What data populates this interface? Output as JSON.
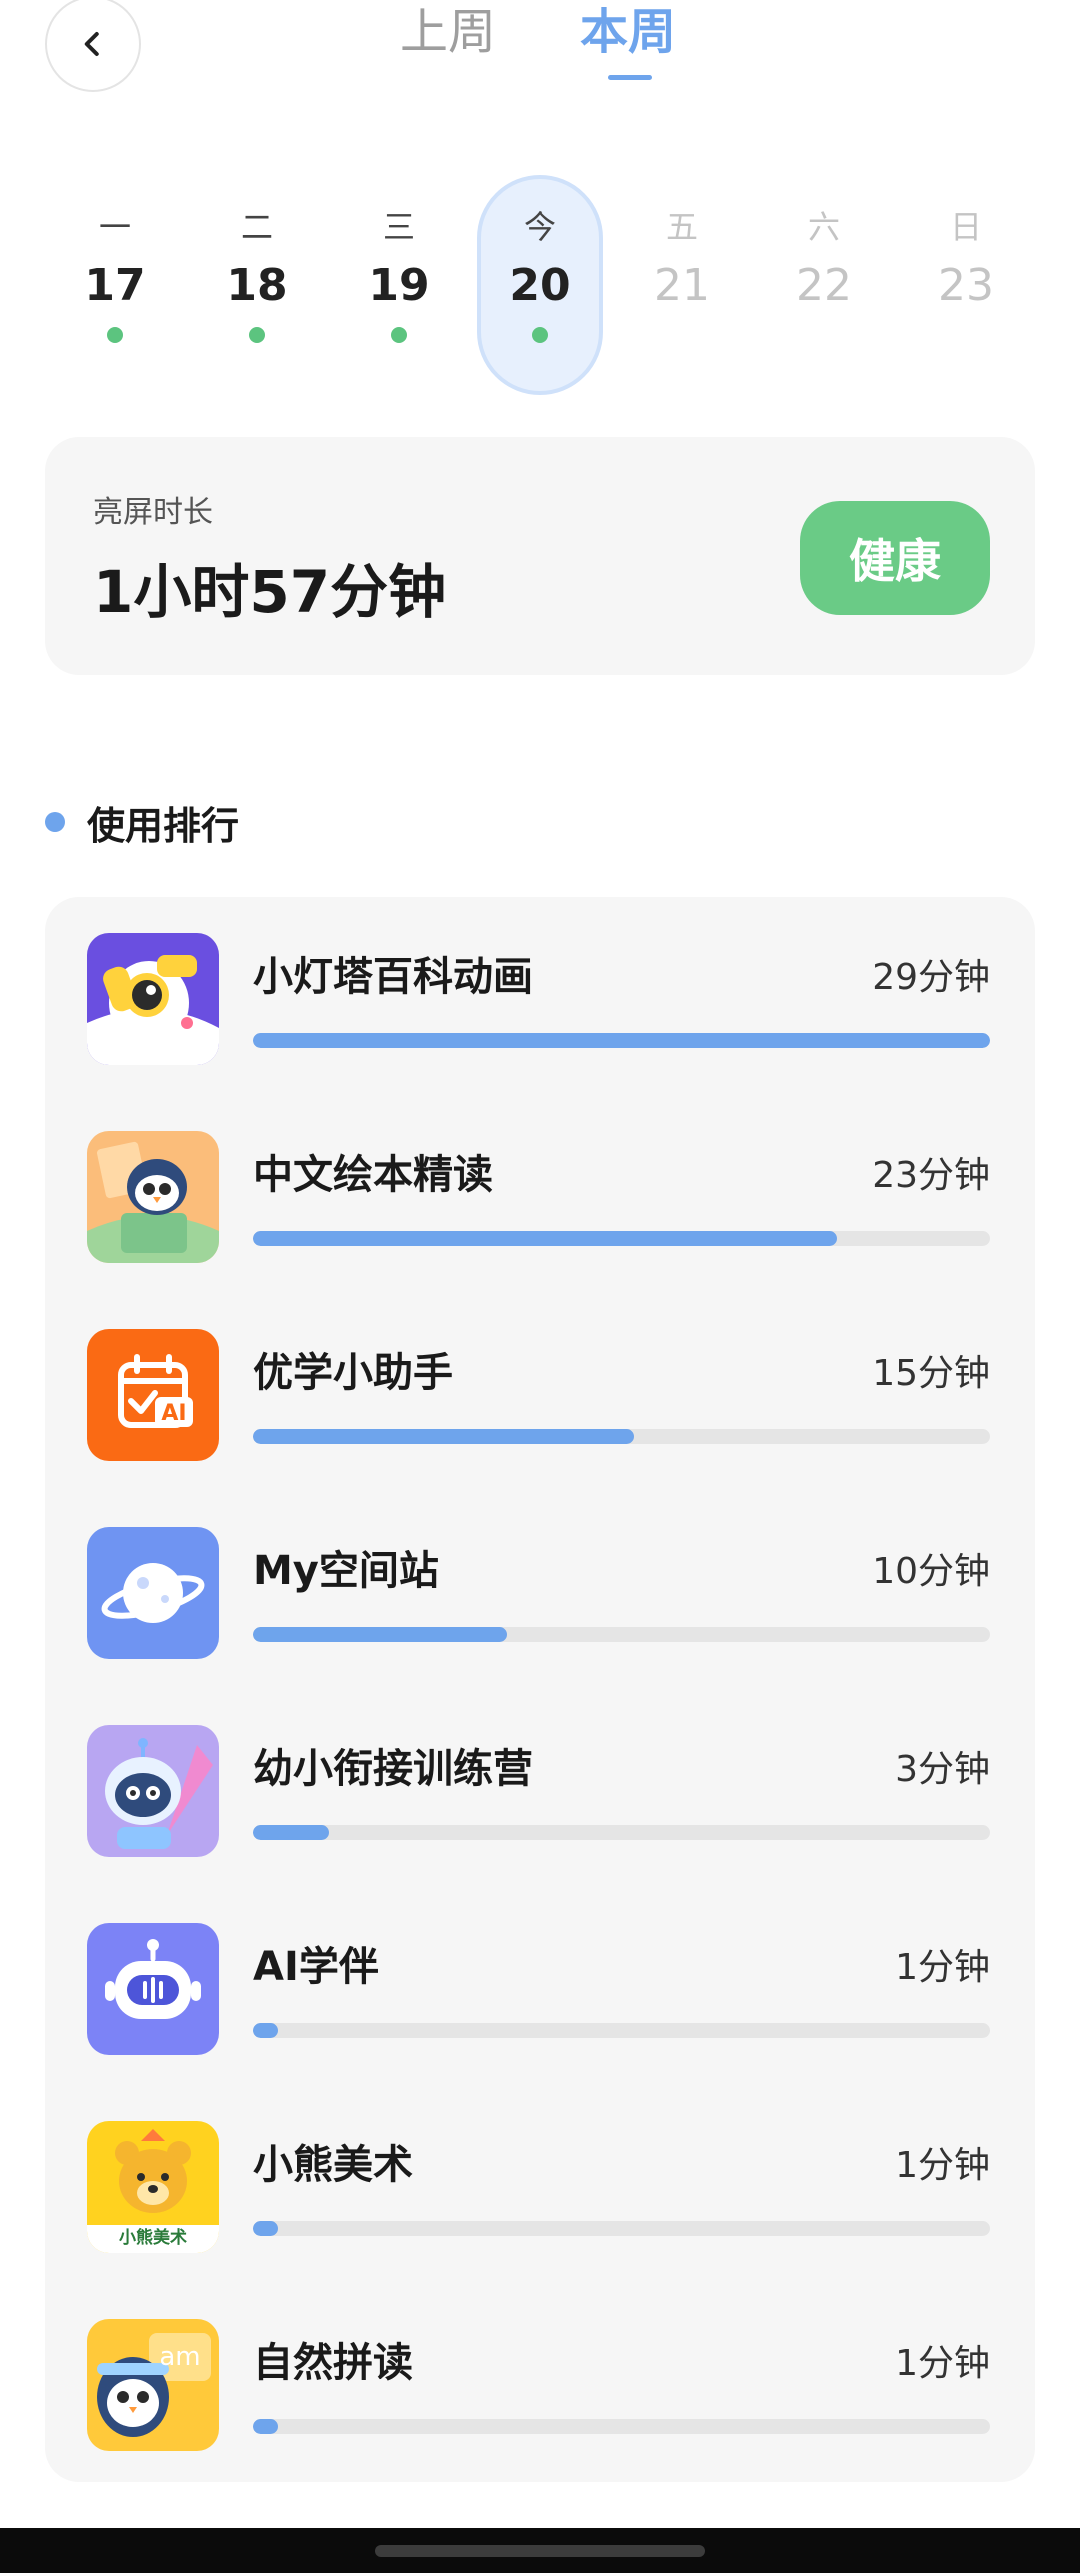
{
  "header": {
    "back_icon": "chevron-left-icon",
    "tabs": [
      {
        "label": "上周",
        "active": false
      },
      {
        "label": "本周",
        "active": true
      }
    ],
    "accent_color": "#6ea4ec"
  },
  "week": {
    "days": [
      {
        "weekday": "一",
        "date": "17",
        "has_usage": true,
        "state": "past"
      },
      {
        "weekday": "二",
        "date": "18",
        "has_usage": true,
        "state": "past"
      },
      {
        "weekday": "三",
        "date": "19",
        "has_usage": true,
        "state": "past"
      },
      {
        "weekday": "今",
        "date": "20",
        "has_usage": true,
        "state": "today"
      },
      {
        "weekday": "五",
        "date": "21",
        "has_usage": false,
        "state": "future"
      },
      {
        "weekday": "六",
        "date": "22",
        "has_usage": false,
        "state": "future"
      },
      {
        "weekday": "日",
        "date": "23",
        "has_usage": false,
        "state": "future"
      }
    ],
    "usage_dot_color": "#5cc47f"
  },
  "screen_time": {
    "label": "亮屏时长",
    "value": "1小时57分钟",
    "status_button": "健康",
    "status_color": "#6acb86"
  },
  "ranking": {
    "title": "使用排行",
    "apps": [
      {
        "name": "小灯塔百科动画",
        "time": "29分钟",
        "progress": 1.0,
        "icon": "lighthouse-mascot-icon"
      },
      {
        "name": "中文绘本精读",
        "time": "23分钟",
        "progress": 0.793,
        "icon": "picture-book-penguin-icon"
      },
      {
        "name": "优学小助手",
        "time": "15分钟",
        "progress": 0.517,
        "icon": "calendar-ai-icon"
      },
      {
        "name": "My空间站",
        "time": "10分钟",
        "progress": 0.345,
        "icon": "planet-icon"
      },
      {
        "name": "幼小衔接训练营",
        "time": "3分钟",
        "progress": 0.103,
        "icon": "robot-penguin-icon"
      },
      {
        "name": "AI学伴",
        "time": "1分钟",
        "progress": 0.034,
        "icon": "robot-head-icon"
      },
      {
        "name": "小熊美术",
        "time": "1分钟",
        "progress": 0.034,
        "icon": "bear-art-icon",
        "icon_caption": "小熊美术"
      },
      {
        "name": "自然拼读",
        "time": "1分钟",
        "progress": 0.034,
        "icon": "phonics-penguin-icon",
        "icon_caption": "am"
      }
    ]
  }
}
